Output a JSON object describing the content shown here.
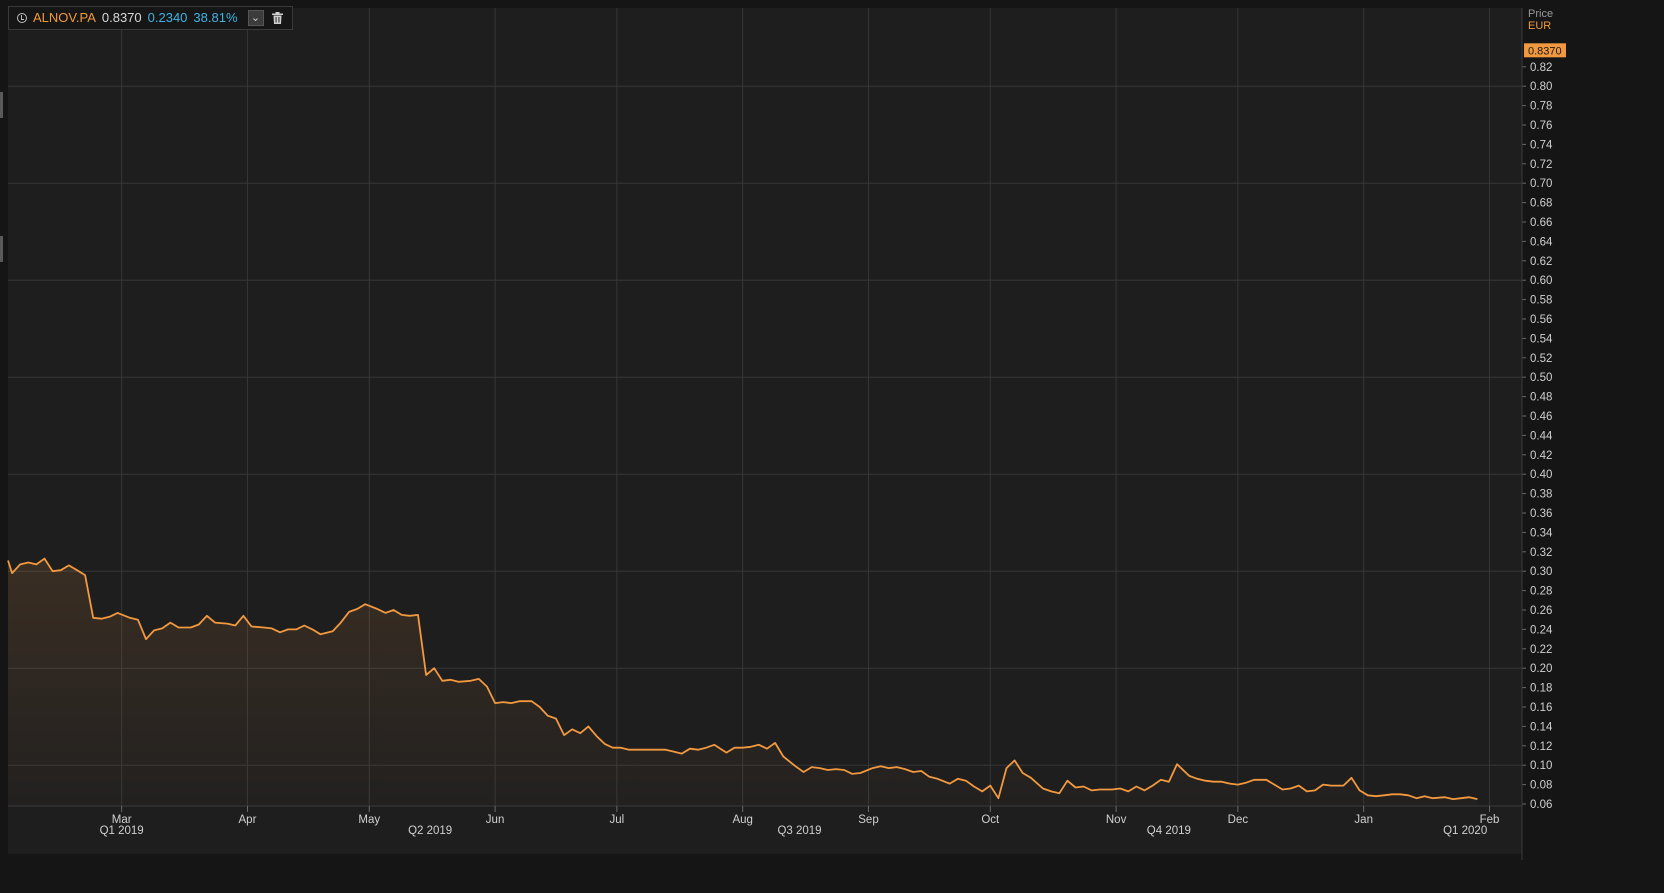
{
  "legend": {
    "ric": "ALNOV.PA",
    "last": "0.8370",
    "change": "0.2340",
    "change_pct": "38.81%",
    "clock_icon": "clock-icon",
    "dropdown_icon": "chevron-down-icon",
    "delete_icon": "trash-icon"
  },
  "axis": {
    "price_label": "Price",
    "currency_label": "EUR",
    "last_badge": "0.8370"
  },
  "colors": {
    "background": "#151515",
    "plot_background": "#1e1e1f",
    "grid": "#363636",
    "line": "#f2993f",
    "badge": "#f2993f",
    "change": "#3fb3e3"
  },
  "chart_data": {
    "type": "area",
    "ylim": [
      0.06,
      0.85
    ],
    "y_ticks": [
      "0.06",
      "0.08",
      "0.10",
      "0.12",
      "0.14",
      "0.16",
      "0.18",
      "0.20",
      "0.22",
      "0.24",
      "0.26",
      "0.28",
      "0.30",
      "0.32",
      "0.34",
      "0.36",
      "0.38",
      "0.40",
      "0.42",
      "0.44",
      "0.46",
      "0.48",
      "0.50",
      "0.52",
      "0.54",
      "0.56",
      "0.58",
      "0.60",
      "0.62",
      "0.64",
      "0.66",
      "0.68",
      "0.70",
      "0.72",
      "0.74",
      "0.76",
      "0.78",
      "0.80",
      "0.82"
    ],
    "major_y_ticks": [
      "0.10",
      "0.20",
      "0.30",
      "0.40",
      "0.50",
      "0.60",
      "0.70",
      "0.80"
    ],
    "x_start": "2019-02-01",
    "x_end": "2020-02-09",
    "months": [
      {
        "label": "Mar",
        "date": "2019-03-01"
      },
      {
        "label": "Apr",
        "date": "2019-04-01"
      },
      {
        "label": "May",
        "date": "2019-05-01"
      },
      {
        "label": "Jun",
        "date": "2019-06-01"
      },
      {
        "label": "Jul",
        "date": "2019-07-01"
      },
      {
        "label": "Aug",
        "date": "2019-08-01"
      },
      {
        "label": "Sep",
        "date": "2019-09-01"
      },
      {
        "label": "Oct",
        "date": "2019-10-01"
      },
      {
        "label": "Nov",
        "date": "2019-11-01"
      },
      {
        "label": "Dec",
        "date": "2019-12-01"
      },
      {
        "label": "Jan",
        "date": "2020-01-01"
      },
      {
        "label": "Feb",
        "date": "2020-02-01"
      }
    ],
    "quarters": [
      {
        "label": "Q1 2019",
        "date": "2019-03-01"
      },
      {
        "label": "Q2 2019",
        "date": "2019-05-16"
      },
      {
        "label": "Q3 2019",
        "date": "2019-08-15"
      },
      {
        "label": "Q4 2019",
        "date": "2019-11-14"
      },
      {
        "label": "Q1 2020",
        "date": "2020-01-26"
      }
    ],
    "series": [
      {
        "name": "ALNOV.PA",
        "points": [
          [
            "2019-02-01",
            0.311
          ],
          [
            "2019-02-02",
            0.298
          ],
          [
            "2019-02-04",
            0.307
          ],
          [
            "2019-02-06",
            0.309
          ],
          [
            "2019-02-08",
            0.307
          ],
          [
            "2019-02-10",
            0.313
          ],
          [
            "2019-02-12",
            0.3
          ],
          [
            "2019-02-14",
            0.301
          ],
          [
            "2019-02-16",
            0.306
          ],
          [
            "2019-02-18",
            0.301
          ],
          [
            "2019-02-20",
            0.296
          ],
          [
            "2019-02-22",
            0.252
          ],
          [
            "2019-02-24",
            0.251
          ],
          [
            "2019-02-26",
            0.253
          ],
          [
            "2019-02-28",
            0.257
          ],
          [
            "2019-03-03",
            0.252
          ],
          [
            "2019-03-05",
            0.25
          ],
          [
            "2019-03-07",
            0.23
          ],
          [
            "2019-03-09",
            0.239
          ],
          [
            "2019-03-11",
            0.241
          ],
          [
            "2019-03-13",
            0.247
          ],
          [
            "2019-03-15",
            0.242
          ],
          [
            "2019-03-18",
            0.242
          ],
          [
            "2019-03-20",
            0.245
          ],
          [
            "2019-03-22",
            0.254
          ],
          [
            "2019-03-24",
            0.247
          ],
          [
            "2019-03-27",
            0.246
          ],
          [
            "2019-03-29",
            0.244
          ],
          [
            "2019-03-31",
            0.254
          ],
          [
            "2019-04-02",
            0.243
          ],
          [
            "2019-04-05",
            0.242
          ],
          [
            "2019-04-07",
            0.241
          ],
          [
            "2019-04-09",
            0.237
          ],
          [
            "2019-04-11",
            0.24
          ],
          [
            "2019-04-13",
            0.24
          ],
          [
            "2019-04-15",
            0.244
          ],
          [
            "2019-04-17",
            0.24
          ],
          [
            "2019-04-19",
            0.235
          ],
          [
            "2019-04-22",
            0.238
          ],
          [
            "2019-04-24",
            0.247
          ],
          [
            "2019-04-26",
            0.258
          ],
          [
            "2019-04-28",
            0.261
          ],
          [
            "2019-04-30",
            0.266
          ],
          [
            "2019-05-03",
            0.261
          ],
          [
            "2019-05-05",
            0.257
          ],
          [
            "2019-05-07",
            0.26
          ],
          [
            "2019-05-09",
            0.255
          ],
          [
            "2019-05-11",
            0.254
          ],
          [
            "2019-05-13",
            0.255
          ],
          [
            "2019-05-15",
            0.193
          ],
          [
            "2019-05-17",
            0.2
          ],
          [
            "2019-05-19",
            0.187
          ],
          [
            "2019-05-21",
            0.188
          ],
          [
            "2019-05-23",
            0.186
          ],
          [
            "2019-05-26",
            0.187
          ],
          [
            "2019-05-28",
            0.189
          ],
          [
            "2019-05-30",
            0.181
          ],
          [
            "2019-06-01",
            0.164
          ],
          [
            "2019-06-03",
            0.165
          ],
          [
            "2019-06-05",
            0.164
          ],
          [
            "2019-06-07",
            0.166
          ],
          [
            "2019-06-10",
            0.166
          ],
          [
            "2019-06-12",
            0.16
          ],
          [
            "2019-06-14",
            0.151
          ],
          [
            "2019-06-16",
            0.148
          ],
          [
            "2019-06-18",
            0.131
          ],
          [
            "2019-06-20",
            0.137
          ],
          [
            "2019-06-22",
            0.133
          ],
          [
            "2019-06-24",
            0.14
          ],
          [
            "2019-06-26",
            0.13
          ],
          [
            "2019-06-28",
            0.122
          ],
          [
            "2019-06-30",
            0.118
          ],
          [
            "2019-07-02",
            0.118
          ],
          [
            "2019-07-04",
            0.116
          ],
          [
            "2019-07-07",
            0.116
          ],
          [
            "2019-07-09",
            0.116
          ],
          [
            "2019-07-11",
            0.116
          ],
          [
            "2019-07-13",
            0.116
          ],
          [
            "2019-07-15",
            0.114
          ],
          [
            "2019-07-17",
            0.112
          ],
          [
            "2019-07-19",
            0.117
          ],
          [
            "2019-07-21",
            0.116
          ],
          [
            "2019-07-23",
            0.118
          ],
          [
            "2019-07-25",
            0.121
          ],
          [
            "2019-07-28",
            0.113
          ],
          [
            "2019-07-30",
            0.118
          ],
          [
            "2019-08-01",
            0.118
          ],
          [
            "2019-08-03",
            0.119
          ],
          [
            "2019-08-05",
            0.121
          ],
          [
            "2019-08-07",
            0.117
          ],
          [
            "2019-08-09",
            0.123
          ],
          [
            "2019-08-11",
            0.109
          ],
          [
            "2019-08-14",
            0.099
          ],
          [
            "2019-08-16",
            0.093
          ],
          [
            "2019-08-18",
            0.098
          ],
          [
            "2019-08-20",
            0.097
          ],
          [
            "2019-08-22",
            0.095
          ],
          [
            "2019-08-24",
            0.096
          ],
          [
            "2019-08-26",
            0.095
          ],
          [
            "2019-08-28",
            0.091
          ],
          [
            "2019-08-30",
            0.092
          ],
          [
            "2019-09-02",
            0.097
          ],
          [
            "2019-09-04",
            0.099
          ],
          [
            "2019-09-06",
            0.097
          ],
          [
            "2019-09-08",
            0.098
          ],
          [
            "2019-09-10",
            0.096
          ],
          [
            "2019-09-12",
            0.093
          ],
          [
            "2019-09-14",
            0.094
          ],
          [
            "2019-09-16",
            0.088
          ],
          [
            "2019-09-18",
            0.086
          ],
          [
            "2019-09-21",
            0.081
          ],
          [
            "2019-09-23",
            0.086
          ],
          [
            "2019-09-25",
            0.084
          ],
          [
            "2019-09-27",
            0.078
          ],
          [
            "2019-09-29",
            0.073
          ],
          [
            "2019-10-01",
            0.079
          ],
          [
            "2019-10-03",
            0.066
          ],
          [
            "2019-10-05",
            0.097
          ],
          [
            "2019-10-07",
            0.105
          ],
          [
            "2019-10-09",
            0.092
          ],
          [
            "2019-10-11",
            0.087
          ],
          [
            "2019-10-14",
            0.076
          ],
          [
            "2019-10-16",
            0.073
          ],
          [
            "2019-10-18",
            0.071
          ],
          [
            "2019-10-20",
            0.084
          ],
          [
            "2019-10-22",
            0.077
          ],
          [
            "2019-10-24",
            0.078
          ],
          [
            "2019-10-26",
            0.074
          ],
          [
            "2019-10-28",
            0.075
          ],
          [
            "2019-10-31",
            0.075
          ],
          [
            "2019-11-02",
            0.076
          ],
          [
            "2019-11-04",
            0.073
          ],
          [
            "2019-11-06",
            0.078
          ],
          [
            "2019-11-08",
            0.074
          ],
          [
            "2019-11-10",
            0.079
          ],
          [
            "2019-11-12",
            0.085
          ],
          [
            "2019-11-14",
            0.083
          ],
          [
            "2019-11-16",
            0.101
          ],
          [
            "2019-11-19",
            0.089
          ],
          [
            "2019-11-21",
            0.086
          ],
          [
            "2019-11-23",
            0.084
          ],
          [
            "2019-11-25",
            0.083
          ],
          [
            "2019-11-27",
            0.083
          ],
          [
            "2019-11-29",
            0.081
          ],
          [
            "2019-12-01",
            0.08
          ],
          [
            "2019-12-03",
            0.082
          ],
          [
            "2019-12-05",
            0.085
          ],
          [
            "2019-12-08",
            0.085
          ],
          [
            "2019-12-10",
            0.08
          ],
          [
            "2019-12-12",
            0.075
          ],
          [
            "2019-12-14",
            0.076
          ],
          [
            "2019-12-16",
            0.079
          ],
          [
            "2019-12-18",
            0.073
          ],
          [
            "2019-12-20",
            0.074
          ],
          [
            "2019-12-22",
            0.08
          ],
          [
            "2019-12-24",
            0.079
          ],
          [
            "2019-12-27",
            0.079
          ],
          [
            "2019-12-29",
            0.087
          ],
          [
            "2019-12-31",
            0.074
          ],
          [
            "2020-01-02",
            0.069
          ],
          [
            "2020-01-04",
            0.068
          ],
          [
            "2020-01-06",
            0.069
          ],
          [
            "2020-01-08",
            0.07
          ],
          [
            "2020-01-10",
            0.07
          ],
          [
            "2020-01-12",
            0.069
          ],
          [
            "2020-01-14",
            0.066
          ],
          [
            "2020-01-16",
            0.068
          ],
          [
            "2020-01-18",
            0.066
          ],
          [
            "2020-01-21",
            0.067
          ],
          [
            "2020-01-23",
            0.065
          ],
          [
            "2020-01-25",
            0.066
          ],
          [
            "2020-01-27",
            0.067
          ],
          [
            "2020-01-29",
            0.065
          ]
        ]
      }
    ]
  }
}
